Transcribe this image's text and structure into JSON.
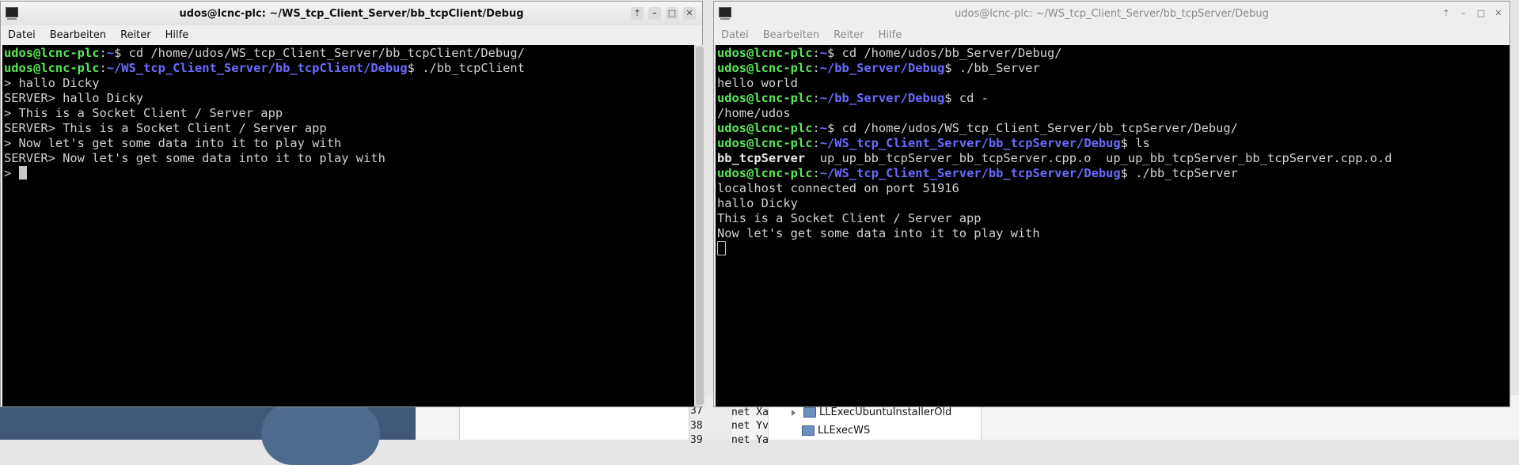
{
  "left_window": {
    "title": "udos@lcnc-plc: ~/WS_tcp_Client_Server/bb_tcpClient/Debug",
    "menu": [
      "Datei",
      "Bearbeiten",
      "Reiter",
      "Hilfe"
    ],
    "lines": [
      {
        "user": "udos@lcnc-plc",
        "path": "~",
        "cmd": " cd /home/udos/WS_tcp_Client_Server/bb_tcpClient/Debug/"
      },
      {
        "user": "udos@lcnc-plc",
        "path": "~/WS_tcp_Client_Server/bb_tcpClient/Debug",
        "cmd": " ./bb_tcpClient"
      },
      {
        "text": "> hallo Dicky"
      },
      {
        "text": "SERVER> hallo Dicky"
      },
      {
        "text": "> This is a Socket Client / Server app"
      },
      {
        "text": "SERVER> This is a Socket Client / Server app"
      },
      {
        "text": "> Now let's get some data into it to play with"
      },
      {
        "text": "SERVER> Now let's get some data into it to play with"
      },
      {
        "text": "> ",
        "cursor": "solid"
      }
    ]
  },
  "right_window": {
    "title": "udos@lcnc-plc: ~/WS_tcp_Client_Server/bb_tcpServer/Debug",
    "menu": [
      "Datei",
      "Bearbeiten",
      "Reiter",
      "Hilfe"
    ],
    "lines": [
      {
        "user": "udos@lcnc-plc",
        "path": "~",
        "cmd": " cd /home/udos/bb_Server/Debug/"
      },
      {
        "user": "udos@lcnc-plc",
        "path": "~/bb_Server/Debug",
        "cmd": " ./bb_Server"
      },
      {
        "text": "hello world"
      },
      {
        "user": "udos@lcnc-plc",
        "path": "~/bb_Server/Debug",
        "cmd": " cd -"
      },
      {
        "text": "/home/udos"
      },
      {
        "user": "udos@lcnc-plc",
        "path": "~",
        "cmd": " cd /home/udos/WS_tcp_Client_Server/bb_tcpServer/Debug/"
      },
      {
        "user": "udos@lcnc-plc",
        "path": "~/WS_tcp_Client_Server/bb_tcpServer/Debug",
        "cmd": " ls"
      },
      {
        "boldtext": "bb_tcpServer",
        "text": "  up_up_bb_tcpServer_bb_tcpServer.cpp.o  up_up_bb_tcpServer_bb_tcpServer.cpp.o.d"
      },
      {
        "user": "udos@lcnc-plc",
        "path": "~/WS_tcp_Client_Server/bb_tcpServer/Debug",
        "cmd": " ./bb_tcpServer"
      },
      {
        "text": "localhost connected on port 51916"
      },
      {
        "text": "hallo Dicky"
      },
      {
        "text": "This is a Socket Client / Server app"
      },
      {
        "text": "Now let's get some data into it to play with"
      },
      {
        "text": "",
        "cursor": "hollow"
      }
    ]
  },
  "background": {
    "gutter_numbers": [
      "37",
      "38",
      "39"
    ],
    "code_lines": [
      "net Xa",
      "net Yv",
      "net Ya"
    ],
    "tree_items": [
      {
        "label": "LLExecUbuntuInstallerOld",
        "expandable": true
      },
      {
        "label": "LLExecWS",
        "expandable": false
      }
    ]
  }
}
